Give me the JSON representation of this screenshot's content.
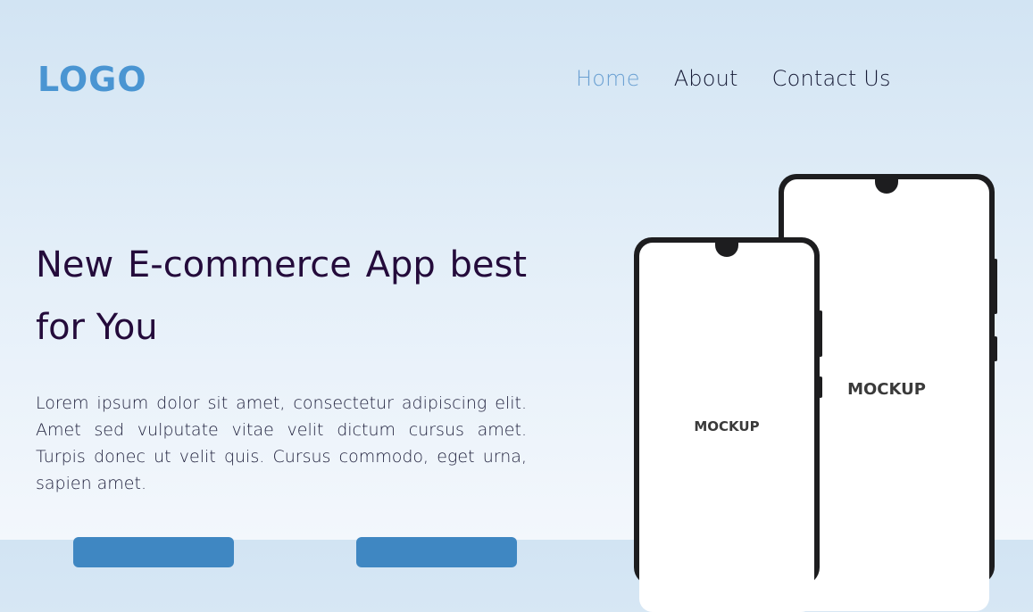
{
  "brand": {
    "logo_text": "LOGO",
    "accent_color": "#4a95d2"
  },
  "nav": {
    "items": [
      {
        "label": "Home",
        "active": true
      },
      {
        "label": "About",
        "active": false
      },
      {
        "label": "Contact Us",
        "active": false
      }
    ]
  },
  "hero": {
    "title": "New E-commerce App best for You",
    "description": "Lorem ipsum dolor sit amet, consectetur adipiscing elit. Amet sed vulputate vitae velit dictum cursus amet. Turpis donec ut velit quis. Cursus commodo, eget urna, sapien amet.",
    "button_color": "#3f87c2"
  },
  "phones": {
    "back_label": "MOCKUP",
    "front_label": "MOCKUP"
  }
}
